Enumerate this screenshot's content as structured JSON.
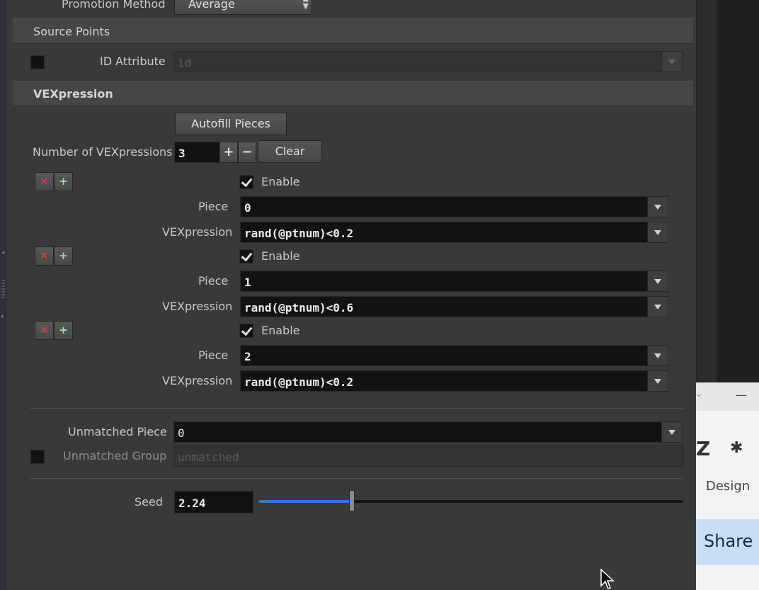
{
  "promotion": {
    "label": "Promotion Method",
    "value": "Average"
  },
  "source_points": {
    "header": "Source Points",
    "id_attribute_label": "ID Attribute",
    "id_attribute_placeholder": "id",
    "enabled": false
  },
  "vexpression": {
    "header": "VEXpression",
    "autofill_label": "Autofill Pieces",
    "count_label": "Number of VEXpressions",
    "count_value": "3",
    "plus_symbol": "+",
    "minus_symbol": "−",
    "clear_label": "Clear",
    "remove_symbol": "✕",
    "insert_symbol": "+",
    "enable_label": "Enable",
    "piece_label": "Piece",
    "expr_label": "VEXpression",
    "entries": [
      {
        "enabled": true,
        "piece": "0",
        "expression": "rand(@ptnum)<0.2"
      },
      {
        "enabled": true,
        "piece": "1",
        "expression": "rand(@ptnum)<0.6"
      },
      {
        "enabled": true,
        "piece": "2",
        "expression": "rand(@ptnum)<0.2"
      }
    ]
  },
  "unmatched": {
    "piece_label": "Unmatched Piece",
    "piece_value": "0",
    "group_label": "Unmatched Group",
    "group_placeholder": "unmatched",
    "group_enabled": false
  },
  "seed": {
    "label": "Seed",
    "value": "2.24",
    "slider_fraction": 0.22
  },
  "browser_panel": {
    "z_glyph": "Z",
    "puzzle_glyph": "✱",
    "minimize_glyph": "—",
    "chevron_glyph": "⌄",
    "design_label": "Design",
    "share_label": "Share"
  },
  "colors": {
    "accent": "#2f78d8",
    "remove": "#ea3b3b",
    "share_bg": "#c8def5"
  }
}
